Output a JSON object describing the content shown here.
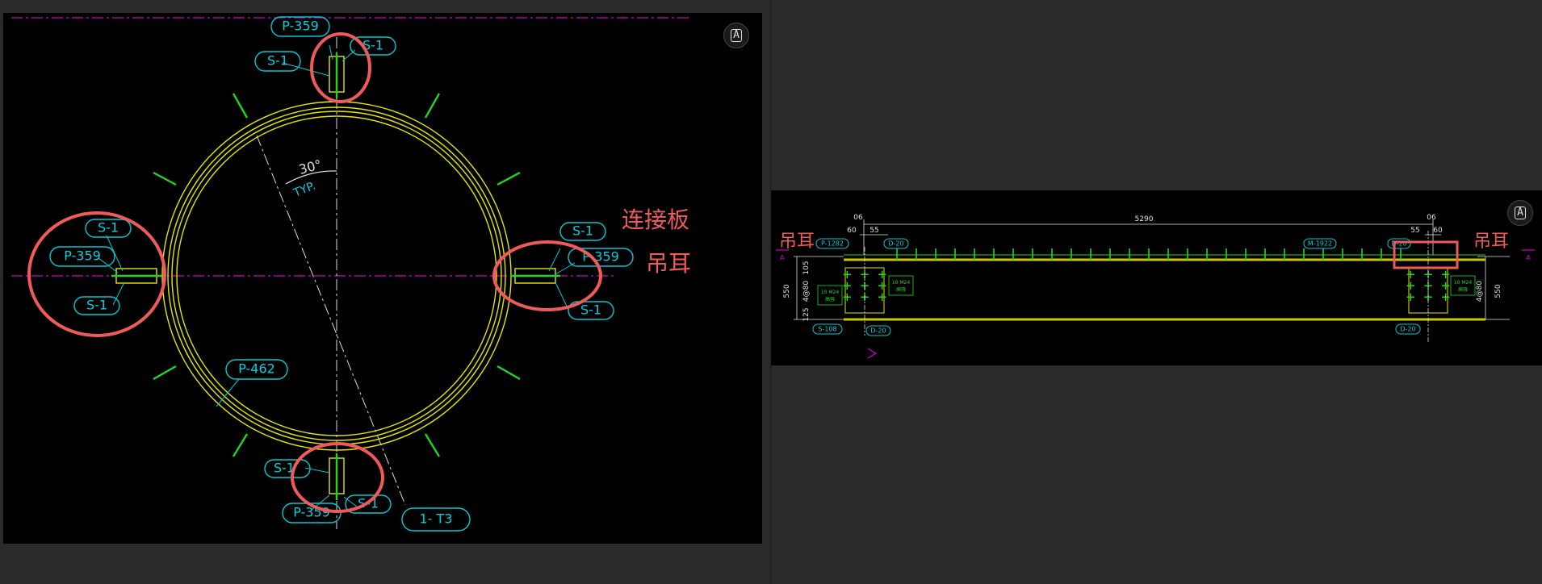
{
  "left_drawing": {
    "tags": {
      "top_p": "P-359",
      "top_s_left": "S-1",
      "top_s_right": "S-1",
      "left_s_top": "S-1",
      "left_p": "P-359",
      "left_s_bottom": "S-1",
      "right_s_top": "S-1",
      "right_p": "P-359",
      "right_s_bottom": "S-1",
      "bottom_s_left": "S-1",
      "bottom_p": "P-359",
      "bottom_s_right": "S-1",
      "ring": "P-462",
      "section": "1- T3"
    },
    "angle_label": "30°",
    "typ_label": "TYP.",
    "annotation_plate": "连接板",
    "annotation_lug": "吊耳"
  },
  "right_drawing": {
    "dim_total": "5290",
    "dim_left_a": "60",
    "dim_left_b": "55",
    "dim_left_c": "06",
    "dim_right_a": "55",
    "dim_right_b": "60",
    "dim_right_c": "06",
    "dim_height": "550",
    "dim_holes": "4@80",
    "dim_top": "105",
    "dim_bottom": "125",
    "tag_p1282": "P-1282",
    "tag_d20_a": "D-20",
    "tag_m1922": "M-1922",
    "tag_d20_b": "D-20",
    "tag_s108": "S-108",
    "tag_d20_c": "D-20",
    "tag_d20_d": "D-20",
    "bolt_note": "10 M24",
    "bolt_note_sub": "高强",
    "section_mark": "A",
    "annotation_lug_left": "吊耳",
    "annotation_lug_right": "吊耳"
  },
  "colors": {
    "cad_bg": "#000000",
    "app_bg": "#2b2b2b",
    "annotation": "#f05a5a",
    "cyan": "#00c8d8",
    "yellow": "#e6e600",
    "green": "#1ed81e",
    "magenta": "#d000d0"
  },
  "icons": [
    "ocr-text-icon",
    "ocr-text-icon"
  ]
}
